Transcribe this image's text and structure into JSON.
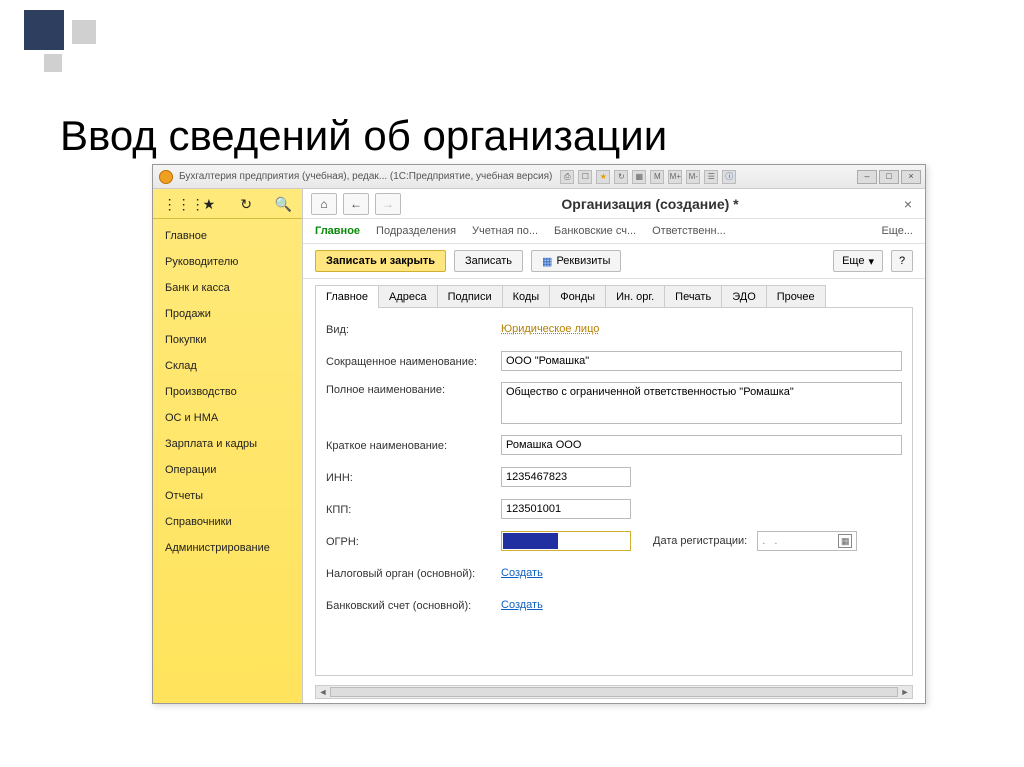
{
  "slide_title": "Ввод сведений об организации",
  "titlebar": {
    "title": "Бухгалтерия предприятия (учебная), редак... (1С:Предприятие, учебная версия)",
    "text_buttons": [
      "M",
      "M+",
      "M-"
    ]
  },
  "sidebar": {
    "items": [
      "Главное",
      "Руководителю",
      "Банк и касса",
      "Продажи",
      "Покупки",
      "Склад",
      "Производство",
      "ОС и НМА",
      "Зарплата и кадры",
      "Операции",
      "Отчеты",
      "Справочники",
      "Администрирование"
    ]
  },
  "page": {
    "title": "Организация (создание) *",
    "sub_tabs": [
      "Главное",
      "Подразделения",
      "Учетная по...",
      "Банковские сч...",
      "Ответственн...",
      "Еще..."
    ],
    "actions": {
      "save_close": "Записать и закрыть",
      "save": "Записать",
      "requisites": "Реквизиты",
      "more": "Еще",
      "help": "?"
    },
    "form_tabs": [
      "Главное",
      "Адреса",
      "Подписи",
      "Коды",
      "Фонды",
      "Ин. орг.",
      "Печать",
      "ЭДО",
      "Прочее"
    ]
  },
  "form": {
    "labels": {
      "vid": "Вид:",
      "short_name": "Сокращенное наименование:",
      "full_name": "Полное наименование:",
      "brief_name": "Краткое наименование:",
      "inn": "ИНН:",
      "kpp": "КПП:",
      "ogrn": "ОГРН:",
      "reg_date": "Дата регистрации:",
      "tax_auth": "Налоговый орган (основной):",
      "bank_acc": "Банковский счет (основной):"
    },
    "values": {
      "vid": "Юридическое лицо",
      "short_name": "ООО \"Ромашка\"",
      "full_name": "Общество с ограниченной ответственностью \"Ромашка\"",
      "brief_name": "Ромашка ООО",
      "inn": "1235467823",
      "kpp": "123501001",
      "reg_date": " .  .    ",
      "create": "Создать"
    }
  }
}
